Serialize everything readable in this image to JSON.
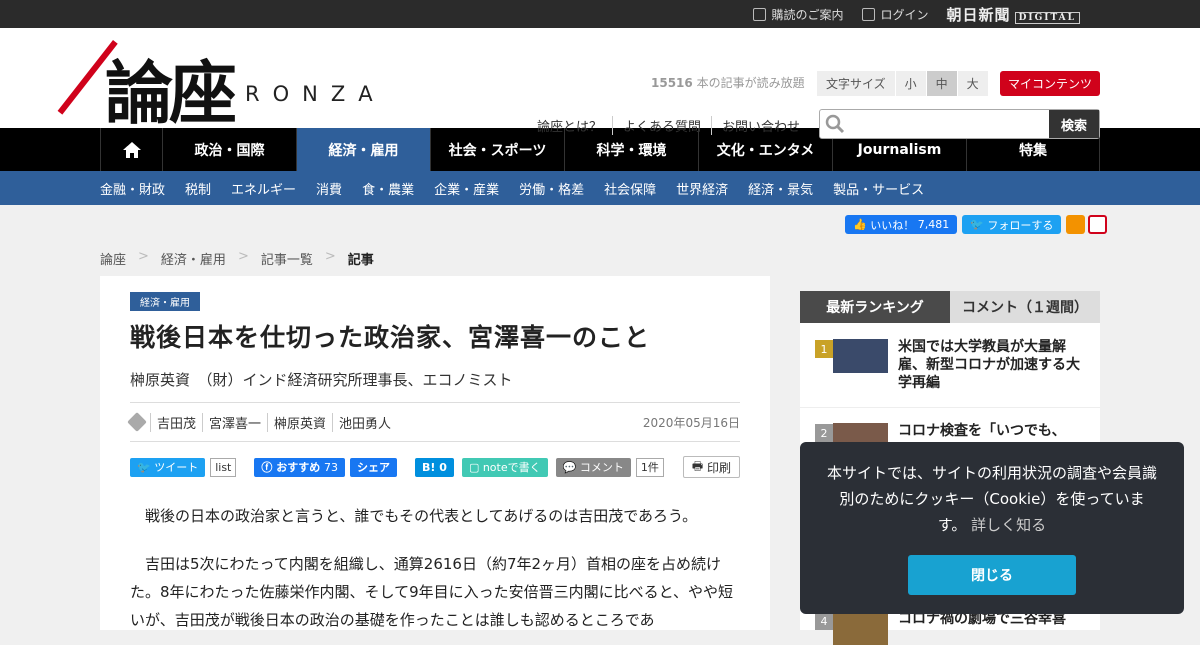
{
  "topbar": {
    "subscription": "購読のご案内",
    "login": "ログイン",
    "brand": "朝日新聞",
    "brand_sub": "DIGITAL"
  },
  "header": {
    "logo_kanji": "論座",
    "logo_latin": "RONZA",
    "read_count": "15516",
    "read_text": "本の記事が読み放題",
    "font_size_label": "文字サイズ",
    "font_sizes": [
      "小",
      "中",
      "大"
    ],
    "font_size_selected": "中",
    "my_content": "マイコンテンツ",
    "links": [
      "論座とは？",
      "よくある質問",
      "お問い合わせ"
    ],
    "search_placeholder": "",
    "search_button": "検索"
  },
  "nav": {
    "items": [
      "政治・国際",
      "経済・雇用",
      "社会・スポーツ",
      "科学・環境",
      "文化・エンタメ",
      "Journalism",
      "特集"
    ],
    "active": "経済・雇用"
  },
  "subnav": [
    "金融・財政",
    "税制",
    "エネルギー",
    "消費",
    "食・農業",
    "企業・産業",
    "労働・格差",
    "社会保障",
    "世界経済",
    "経済・景気",
    "製品・サービス"
  ],
  "social": {
    "fb_label": "いいね！",
    "fb_count": "7,481",
    "tw_label": "フォローする"
  },
  "breadcrumb": [
    "論座",
    "経済・雇用",
    "記事一覧",
    "記事"
  ],
  "breadcrumb_sep": ">",
  "article": {
    "category": "経済・雇用",
    "title": "戦後日本を仕切った政治家、宮澤喜一のこと",
    "author": "榊原英資　（財）インド経済研究所理事長、エコノミスト",
    "tags": [
      "吉田茂",
      "宮澤喜一",
      "榊原英資",
      "池田勇人"
    ],
    "date": "2020年05月16日",
    "share": {
      "tweet": "ツイート",
      "list": "list",
      "fb_recommend": "おすすめ",
      "fb_count": "73",
      "fb_share": "シェア",
      "hatena_count": "0",
      "note": "noteで書く",
      "comment": "コメント",
      "comment_count": "1件",
      "print": "印刷"
    },
    "paragraphs": [
      "戦後の日本の政治家と言うと、誰でもその代表としてあげるのは吉田茂であろう。",
      "吉田は5次にわたって内閣を組織し、通算2616日（約7年2ヶ月）首相の座を占め続けた。8年にわたった佐藤栄作内閣、そして9年目に入った安倍晋三内閣に比べると、やや短いが、吉田茂が戦後日本の政治の基礎を作ったことは誰しも認めるところであ"
    ]
  },
  "sidebar": {
    "tab_ranking": "最新ランキング",
    "tab_comment": "コメント（１週間）",
    "items": [
      {
        "rank": "1",
        "title": "米国では大学教員が大量解雇、新型コロナが加速する大学再編"
      },
      {
        "rank": "2",
        "title": "コロナ検査を「いつでも、"
      },
      {
        "rank": "4",
        "title": "コロナ禍の劇場で三谷幸喜"
      }
    ]
  },
  "cookie": {
    "message": "本サイトでは、サイトの利用状況の調査や会員識別のためにクッキー（Cookie）を使っています。",
    "more": "詳しく知る",
    "close": "閉じる"
  },
  "colors": {
    "accent": "#2f5f9a",
    "brand_red": "#d0021b",
    "nav_bg": "#000000",
    "cookie_bg": "#2b2f36",
    "cookie_button": "#18a2d1"
  }
}
